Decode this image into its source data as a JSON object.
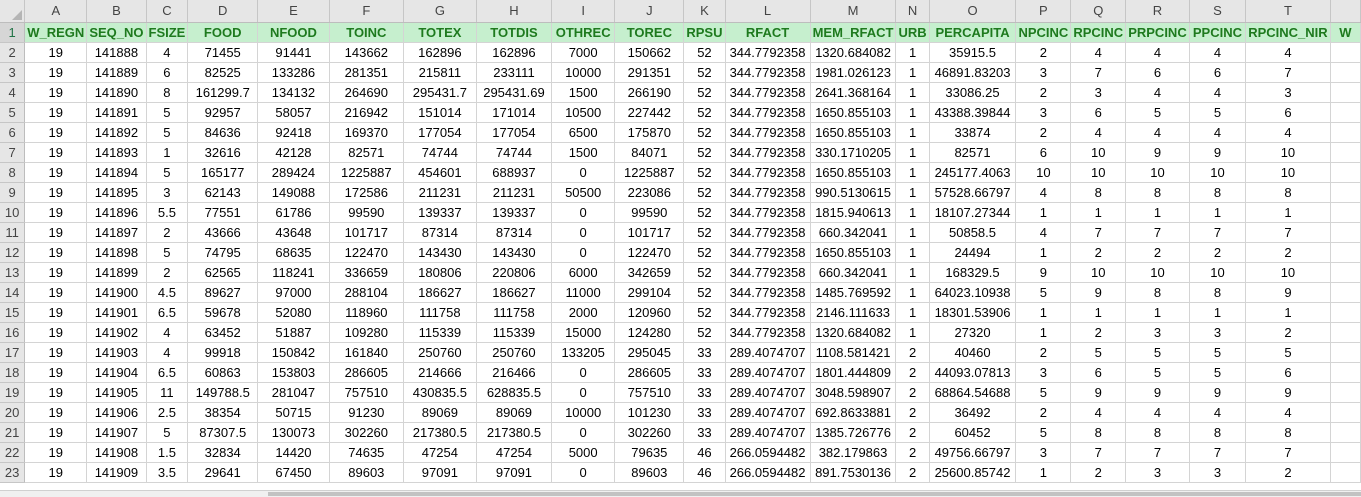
{
  "columns": [
    "A",
    "B",
    "C",
    "D",
    "E",
    "F",
    "G",
    "H",
    "I",
    "J",
    "K",
    "L",
    "M",
    "N",
    "O",
    "P",
    "Q",
    "R",
    "S",
    "T"
  ],
  "column_partial": "",
  "headers": [
    "W_REGN",
    "SEQ_NO",
    "FSIZE",
    "FOOD",
    "NFOOD",
    "TOINC",
    "TOTEX",
    "TOTDIS",
    "OTHREC",
    "TOREC",
    "RPSU",
    "RFACT",
    "MEM_RFACT",
    "URB",
    "PERCAPITA",
    "NPCINC",
    "RPCINC",
    "PRPCINC",
    "PPCINC",
    "RPCINC_NIR"
  ],
  "header_overflow": "W",
  "rows": [
    {
      "num": "2",
      "cells": [
        "19",
        "141888",
        "4",
        "71455",
        "91441",
        "143662",
        "162896",
        "162896",
        "7000",
        "150662",
        "52",
        "344.7792358",
        "1320.684082",
        "1",
        "35915.5",
        "2",
        "4",
        "4",
        "4",
        "4"
      ]
    },
    {
      "num": "3",
      "cells": [
        "19",
        "141889",
        "6",
        "82525",
        "133286",
        "281351",
        "215811",
        "233111",
        "10000",
        "291351",
        "52",
        "344.7792358",
        "1981.026123",
        "1",
        "46891.83203",
        "3",
        "7",
        "6",
        "6",
        "7"
      ]
    },
    {
      "num": "4",
      "cells": [
        "19",
        "141890",
        "8",
        "161299.7",
        "134132",
        "264690",
        "295431.7",
        "295431.69",
        "1500",
        "266190",
        "52",
        "344.7792358",
        "2641.368164",
        "1",
        "33086.25",
        "2",
        "3",
        "4",
        "4",
        "3"
      ]
    },
    {
      "num": "5",
      "cells": [
        "19",
        "141891",
        "5",
        "92957",
        "58057",
        "216942",
        "151014",
        "171014",
        "10500",
        "227442",
        "52",
        "344.7792358",
        "1650.855103",
        "1",
        "43388.39844",
        "3",
        "6",
        "5",
        "5",
        "6"
      ]
    },
    {
      "num": "6",
      "cells": [
        "19",
        "141892",
        "5",
        "84636",
        "92418",
        "169370",
        "177054",
        "177054",
        "6500",
        "175870",
        "52",
        "344.7792358",
        "1650.855103",
        "1",
        "33874",
        "2",
        "4",
        "4",
        "4",
        "4"
      ]
    },
    {
      "num": "7",
      "cells": [
        "19",
        "141893",
        "1",
        "32616",
        "42128",
        "82571",
        "74744",
        "74744",
        "1500",
        "84071",
        "52",
        "344.7792358",
        "330.1710205",
        "1",
        "82571",
        "6",
        "10",
        "9",
        "9",
        "10"
      ]
    },
    {
      "num": "8",
      "cells": [
        "19",
        "141894",
        "5",
        "165177",
        "289424",
        "1225887",
        "454601",
        "688937",
        "0",
        "1225887",
        "52",
        "344.7792358",
        "1650.855103",
        "1",
        "245177.4063",
        "10",
        "10",
        "10",
        "10",
        "10"
      ]
    },
    {
      "num": "9",
      "cells": [
        "19",
        "141895",
        "3",
        "62143",
        "149088",
        "172586",
        "211231",
        "211231",
        "50500",
        "223086",
        "52",
        "344.7792358",
        "990.5130615",
        "1",
        "57528.66797",
        "4",
        "8",
        "8",
        "8",
        "8"
      ]
    },
    {
      "num": "10",
      "cells": [
        "19",
        "141896",
        "5.5",
        "77551",
        "61786",
        "99590",
        "139337",
        "139337",
        "0",
        "99590",
        "52",
        "344.7792358",
        "1815.940613",
        "1",
        "18107.27344",
        "1",
        "1",
        "1",
        "1",
        "1"
      ]
    },
    {
      "num": "11",
      "cells": [
        "19",
        "141897",
        "2",
        "43666",
        "43648",
        "101717",
        "87314",
        "87314",
        "0",
        "101717",
        "52",
        "344.7792358",
        "660.342041",
        "1",
        "50858.5",
        "4",
        "7",
        "7",
        "7",
        "7"
      ]
    },
    {
      "num": "12",
      "cells": [
        "19",
        "141898",
        "5",
        "74795",
        "68635",
        "122470",
        "143430",
        "143430",
        "0",
        "122470",
        "52",
        "344.7792358",
        "1650.855103",
        "1",
        "24494",
        "1",
        "2",
        "2",
        "2",
        "2"
      ]
    },
    {
      "num": "13",
      "cells": [
        "19",
        "141899",
        "2",
        "62565",
        "118241",
        "336659",
        "180806",
        "220806",
        "6000",
        "342659",
        "52",
        "344.7792358",
        "660.342041",
        "1",
        "168329.5",
        "9",
        "10",
        "10",
        "10",
        "10"
      ]
    },
    {
      "num": "14",
      "cells": [
        "19",
        "141900",
        "4.5",
        "89627",
        "97000",
        "288104",
        "186627",
        "186627",
        "11000",
        "299104",
        "52",
        "344.7792358",
        "1485.769592",
        "1",
        "64023.10938",
        "5",
        "9",
        "8",
        "8",
        "9"
      ]
    },
    {
      "num": "15",
      "cells": [
        "19",
        "141901",
        "6.5",
        "59678",
        "52080",
        "118960",
        "111758",
        "111758",
        "2000",
        "120960",
        "52",
        "344.7792358",
        "2146.111633",
        "1",
        "18301.53906",
        "1",
        "1",
        "1",
        "1",
        "1"
      ]
    },
    {
      "num": "16",
      "cells": [
        "19",
        "141902",
        "4",
        "63452",
        "51887",
        "109280",
        "115339",
        "115339",
        "15000",
        "124280",
        "52",
        "344.7792358",
        "1320.684082",
        "1",
        "27320",
        "1",
        "2",
        "3",
        "3",
        "2"
      ]
    },
    {
      "num": "17",
      "cells": [
        "19",
        "141903",
        "4",
        "99918",
        "150842",
        "161840",
        "250760",
        "250760",
        "133205",
        "295045",
        "33",
        "289.4074707",
        "1108.581421",
        "2",
        "40460",
        "2",
        "5",
        "5",
        "5",
        "5"
      ]
    },
    {
      "num": "18",
      "cells": [
        "19",
        "141904",
        "6.5",
        "60863",
        "153803",
        "286605",
        "214666",
        "216466",
        "0",
        "286605",
        "33",
        "289.4074707",
        "1801.444809",
        "2",
        "44093.07813",
        "3",
        "6",
        "5",
        "5",
        "6"
      ]
    },
    {
      "num": "19",
      "cells": [
        "19",
        "141905",
        "11",
        "149788.5",
        "281047",
        "757510",
        "430835.5",
        "628835.5",
        "0",
        "757510",
        "33",
        "289.4074707",
        "3048.598907",
        "2",
        "68864.54688",
        "5",
        "9",
        "9",
        "9",
        "9"
      ]
    },
    {
      "num": "20",
      "cells": [
        "19",
        "141906",
        "2.5",
        "38354",
        "50715",
        "91230",
        "89069",
        "89069",
        "10000",
        "101230",
        "33",
        "289.4074707",
        "692.8633881",
        "2",
        "36492",
        "2",
        "4",
        "4",
        "4",
        "4"
      ]
    },
    {
      "num": "21",
      "cells": [
        "19",
        "141907",
        "5",
        "87307.5",
        "130073",
        "302260",
        "217380.5",
        "217380.5",
        "0",
        "302260",
        "33",
        "289.4074707",
        "1385.726776",
        "2",
        "60452",
        "5",
        "8",
        "8",
        "8",
        "8"
      ]
    },
    {
      "num": "22",
      "cells": [
        "19",
        "141908",
        "1.5",
        "32834",
        "14420",
        "74635",
        "47254",
        "47254",
        "5000",
        "79635",
        "46",
        "266.0594482",
        "382.179863",
        "2",
        "49756.66797",
        "3",
        "7",
        "7",
        "7",
        "7"
      ]
    },
    {
      "num": "23",
      "cells": [
        "19",
        "141909",
        "3.5",
        "29641",
        "67450",
        "89603",
        "97091",
        "97091",
        "0",
        "89603",
        "46",
        "266.0594482",
        "891.7530136",
        "2",
        "25600.85742",
        "1",
        "2",
        "3",
        "3",
        "2"
      ]
    }
  ]
}
